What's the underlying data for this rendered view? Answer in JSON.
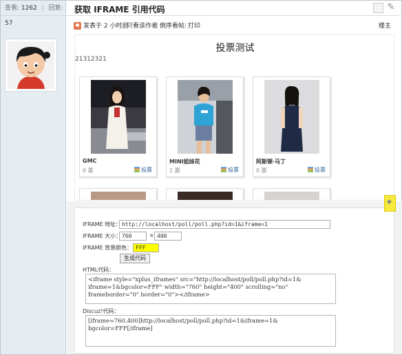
{
  "sidebar": {
    "views_label": "查看:",
    "views_count": "1262",
    "replies_label": "回复:",
    "replies_count": "57"
  },
  "header": {
    "title": "获取 IFRAME 引用代码"
  },
  "postbar": {
    "time": "发表于 2 小时前",
    "only_author": "只看该作者",
    "reverse": "倒序看帖",
    "print": "打印",
    "floor": "楼主"
  },
  "poll": {
    "title": "投票测试",
    "description": "21312321",
    "vote_label": "投票",
    "cards": [
      {
        "name": "GMC",
        "votes": "0 票"
      },
      {
        "name": "MINI姐妹花",
        "votes": "1 票"
      },
      {
        "name": "阿斯顿·马丁",
        "votes": "0 票"
      }
    ]
  },
  "form": {
    "url_label": "IFRAME 地址：",
    "url_value": "http://localhost/poll/poll.php?id=1&iframe=1",
    "size_label": "IFRAME 大小：",
    "width_value": "760",
    "times": "×",
    "height_value": "400",
    "bg_label": "IFRAME 背景颜色：#",
    "bg_value": "FFF",
    "generate_label": "生成代码",
    "html_label": "HTML代码：",
    "html_code": "<iframe style=\"xplus_iframes\" src=\"http://localhost/poll/poll.php?id=1&\niframe=1&bgcolor=FFF\" width=\"760\" height=\"400\" scrolling=\"no\"\nframeborder=\"0\" border=\"0\"></iframe>",
    "discuz_label": "Discuz!代码：",
    "discuz_code": "[iframe=760,400]http://localhost/poll/poll.php?id=1&iframe=1&\nbgcolor=FFF[/iframe]"
  },
  "colors": {
    "sidebar_bg": "#e5edf2",
    "highlight_yellow": "#ffff00",
    "link_blue": "#336699"
  },
  "icons": [
    "user-avatar",
    "author-icon",
    "wrench-icon",
    "vote-icon",
    "resize-handle-icon"
  ]
}
